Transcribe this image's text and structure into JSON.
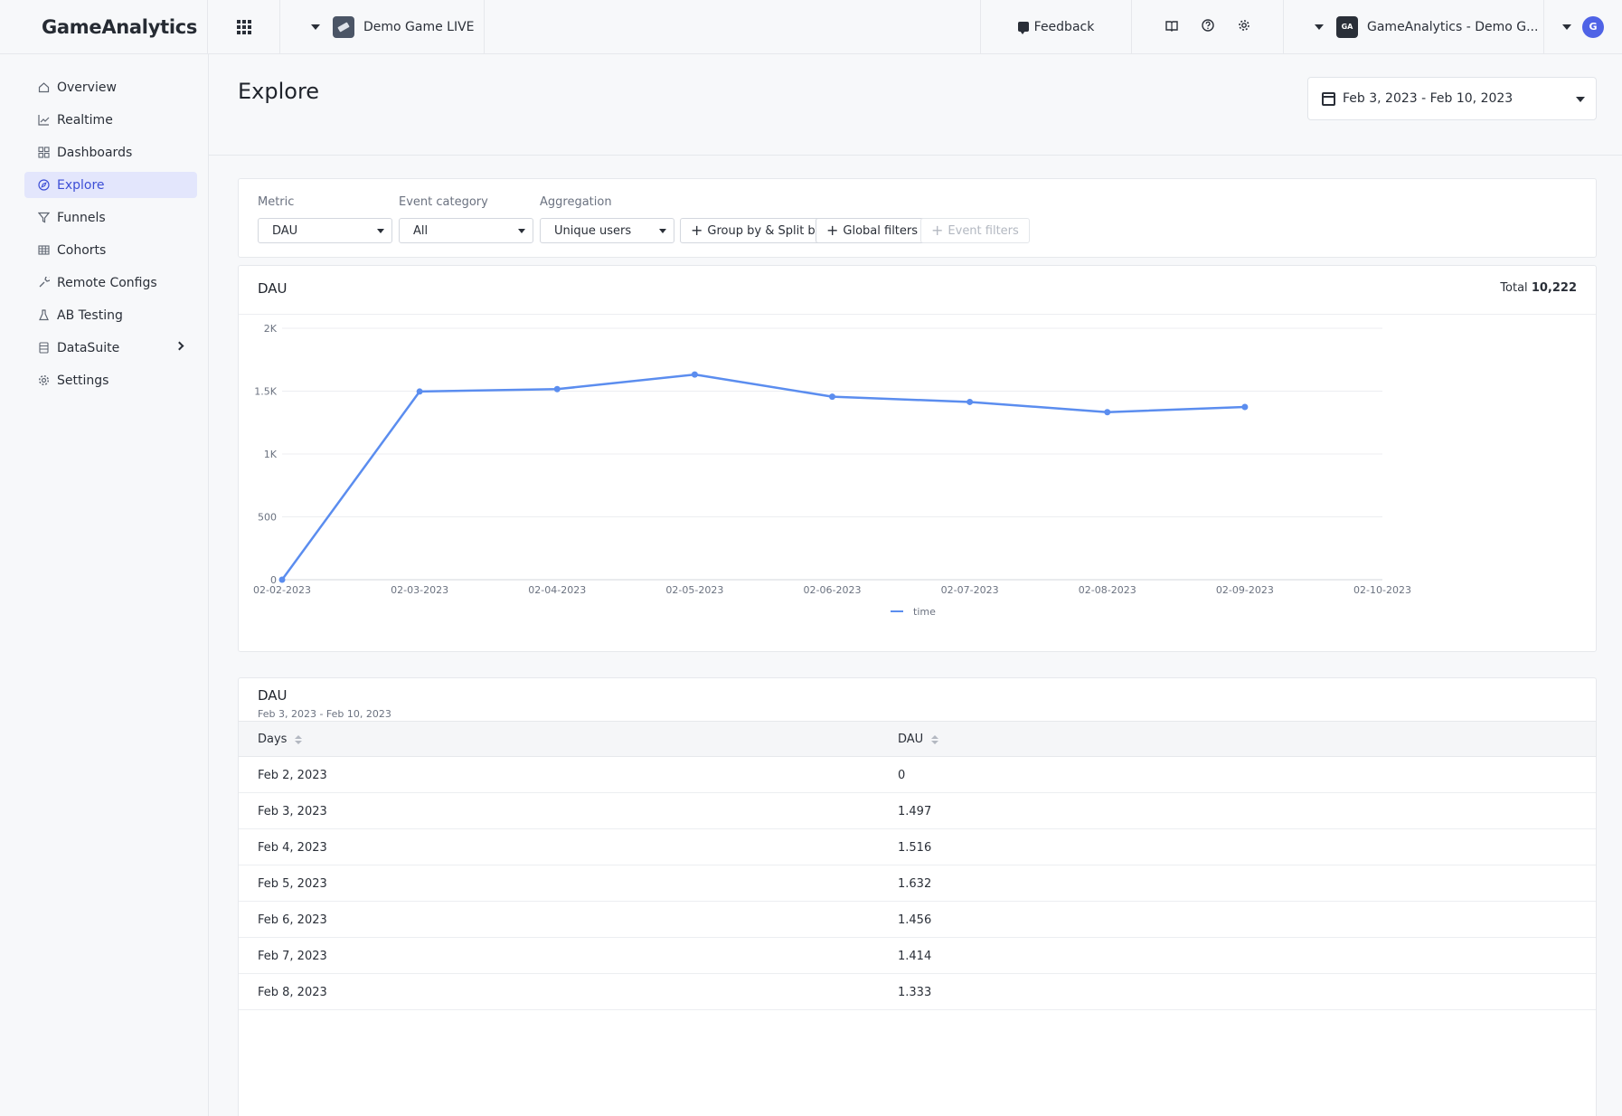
{
  "topbar": {
    "brand": "GameAnalytics",
    "game_name": "Demo Game LIVE",
    "feedback_label": "Feedback",
    "org_name": "GameAnalytics - Demo G...",
    "avatar_initial": "G"
  },
  "sidebar": {
    "items": [
      {
        "label": "Overview",
        "icon": "home-icon"
      },
      {
        "label": "Realtime",
        "icon": "line-chart-icon"
      },
      {
        "label": "Dashboards",
        "icon": "dashboard-icon"
      },
      {
        "label": "Explore",
        "icon": "compass-icon",
        "active": true
      },
      {
        "label": "Funnels",
        "icon": "funnel-icon"
      },
      {
        "label": "Cohorts",
        "icon": "table-icon"
      },
      {
        "label": "Remote Configs",
        "icon": "wrench-icon"
      },
      {
        "label": "AB Testing",
        "icon": "flask-icon"
      },
      {
        "label": "DataSuite",
        "icon": "database-icon"
      },
      {
        "label": "Settings",
        "icon": "gear-icon"
      }
    ]
  },
  "page": {
    "title": "Explore",
    "date_range": "Feb 3, 2023 - Feb 10, 2023"
  },
  "filters": {
    "metric_label": "Metric",
    "metric_value": "DAU",
    "event_category_label": "Event category",
    "event_category_value": "All",
    "aggregation_label": "Aggregation",
    "aggregation_value": "Unique users",
    "group_by_label": "Group by & Split by",
    "global_filters_label": "Global filters",
    "event_filters_label": "Event filters"
  },
  "chart_card": {
    "title": "DAU",
    "total_label": "Total",
    "total_value": "10,222"
  },
  "chart_data": {
    "type": "line",
    "x": [
      "02-02-2023",
      "02-03-2023",
      "02-04-2023",
      "02-05-2023",
      "02-06-2023",
      "02-07-2023",
      "02-08-2023",
      "02-09-2023",
      "02-10-2023"
    ],
    "y_ticks": [
      "0",
      "500",
      "1K",
      "1.5K",
      "2K"
    ],
    "ylim": [
      0,
      2000
    ],
    "series": [
      {
        "name": "time",
        "values": [
          0,
          1497,
          1516,
          1632,
          1456,
          1414,
          1333,
          1374
        ],
        "color": "#5b8def"
      }
    ],
    "grid": true,
    "legend": "bottom-center"
  },
  "table": {
    "title": "DAU",
    "subtitle": "Feb 3, 2023 - Feb 10, 2023",
    "columns": [
      "Days",
      "DAU"
    ],
    "rows": [
      [
        "Feb 2, 2023",
        "0"
      ],
      [
        "Feb 3, 2023",
        "1.497"
      ],
      [
        "Feb 4, 2023",
        "1.516"
      ],
      [
        "Feb 5, 2023",
        "1.632"
      ],
      [
        "Feb 6, 2023",
        "1.456"
      ],
      [
        "Feb 7, 2023",
        "1.414"
      ],
      [
        "Feb 8, 2023",
        "1.333"
      ]
    ]
  },
  "colors": {
    "accent": "#3d4fd6",
    "active_bg": "#e3e6fc",
    "line": "#5b8def"
  }
}
